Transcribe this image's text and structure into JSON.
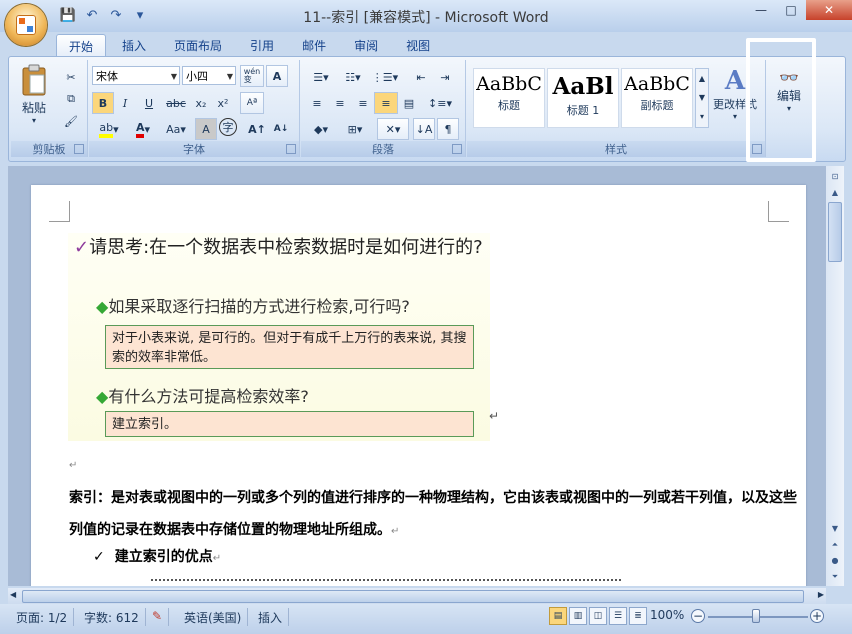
{
  "window": {
    "title": "11--索引 [兼容模式] - Microsoft Word",
    "controls": [
      "—",
      "□",
      "✕"
    ]
  },
  "qat": [
    "💾",
    "↶",
    "↷",
    "▾"
  ],
  "tabs": [
    "开始",
    "插入",
    "页面布局",
    "引用",
    "邮件",
    "审阅",
    "视图"
  ],
  "ribbon": {
    "clipboard": {
      "label": "剪贴板",
      "paste": "粘贴",
      "paste_arrow": "▾"
    },
    "font": {
      "label": "字体",
      "font_name": "宋体",
      "font_size": "小四",
      "wen_btn": "wén\n变",
      "a_box": "A",
      "bold": "B",
      "italic": "I",
      "underline": "U",
      "strike": "abc",
      "sub": "x₂",
      "sup": "x²",
      "clear": "Aª",
      "highlight": "ab",
      "fontcolor": "A",
      "changecase": "Aa",
      "charshade": "A",
      "enclose": "字",
      "grow": "A↑",
      "shrink": "A↓"
    },
    "paragraph": {
      "label": "段落"
    },
    "styles": {
      "label": "样式",
      "items": [
        {
          "sample": "AaBbC",
          "name": "标题"
        },
        {
          "sample": "AaBl",
          "name": "标题 1"
        },
        {
          "sample": "AaBbC",
          "name": "副标题"
        }
      ],
      "change": "更改样式"
    },
    "editing": {
      "label": "编辑"
    }
  },
  "document": {
    "slide": {
      "question": "请思考:在一个数据表中检索数据时是如何进行的?",
      "sub1": "如果采取逐行扫描的方式进行检索,可行吗?",
      "ans1": "对于小表来说, 是可行的。但对于有成千上万行的表来说, 其搜索的效率非常低。",
      "sub2": "有什么方法可提高检索效率?",
      "ans2": "建立索引。"
    },
    "paragraph1": "索引：是对表或视图中的一列或多个列的值进行排序的一种物理结构，它由该表或视图中的一列或若干列值，以及这些列值的记录在数据表中存储位置的物理地址所组成。",
    "bullet1": "建立索引的优点",
    "para_mark": "↵"
  },
  "status": {
    "page": "页面: 1/2",
    "words": "字数: 612",
    "language": "英语(美国)",
    "mode": "插入",
    "zoom": "100%",
    "zoom_minus": "−",
    "zoom_plus": "+"
  }
}
